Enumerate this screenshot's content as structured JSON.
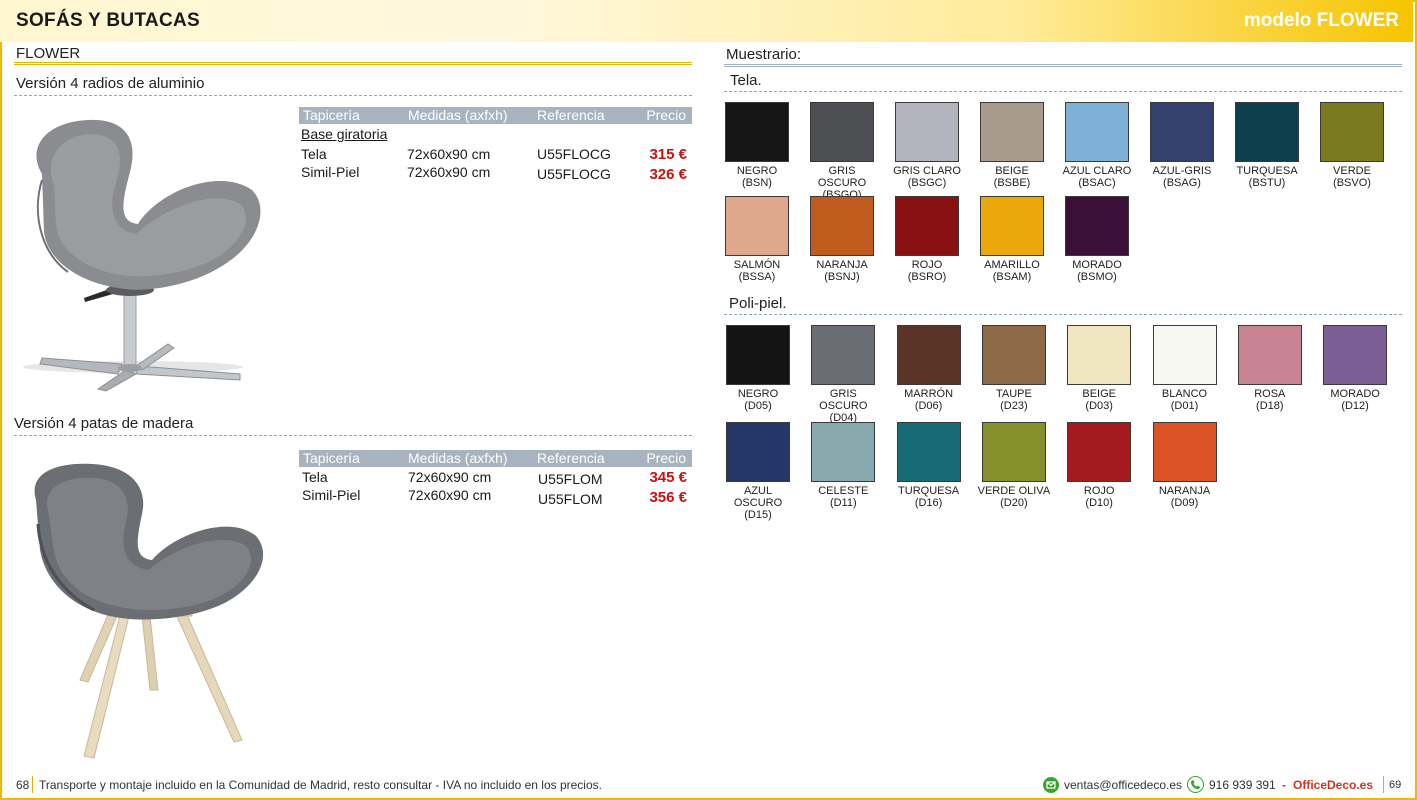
{
  "header": {
    "title": "SOFÁS Y BUTACAS",
    "model": "modelo FLOWER"
  },
  "left": {
    "product": "FLOWER",
    "version1": {
      "title": "Versión 4 radios de aluminio",
      "table_headers": [
        "Tapicería",
        "Medidas (axfxh)",
        "Referencia",
        "Precio"
      ],
      "subheading": "Base giratoria",
      "rows": [
        {
          "tapiceria": "Tela",
          "medidas": "72x60x90 cm",
          "referencia": "U55FLOCG",
          "precio": "315 €"
        },
        {
          "tapiceria": "Simil-Piel",
          "medidas": "72x60x90 cm",
          "referencia": "U55FLOCG",
          "precio": "326 €"
        }
      ]
    },
    "version2": {
      "title": "Versión 4 patas de madera",
      "table_headers": [
        "Tapicería",
        "Medidas (axfxh)",
        "Referencia",
        "Precio"
      ],
      "rows": [
        {
          "tapiceria": "Tela",
          "medidas": "72x60x90 cm",
          "referencia": "U55FLOM",
          "precio": "345 €"
        },
        {
          "tapiceria": "Simil-Piel",
          "medidas": "72x60x90 cm",
          "referencia": "U55FLOM",
          "precio": "356 €"
        }
      ]
    }
  },
  "muestrario": {
    "title": "Muestrario:",
    "tela_title": "Tela.",
    "tela": [
      {
        "name": "NEGRO",
        "code": "(BSN)",
        "color": "#151515"
      },
      {
        "name": "GRIS OSCURO",
        "code": "(BSGO)",
        "color": "#4e4f52"
      },
      {
        "name": "GRIS CLARO",
        "code": "(BSGC)",
        "color": "#b3b3bd"
      },
      {
        "name": "BEIGE",
        "code": "(BSBE)",
        "color": "#a89a8c"
      },
      {
        "name": "AZUL CLARO",
        "code": "(BSAC)",
        "color": "#7fb1d6"
      },
      {
        "name": "AZUL-GRIS",
        "code": "(BSAG)",
        "color": "#34406e"
      },
      {
        "name": "TURQUESA",
        "code": "(BSTU)",
        "color": "#0e3f4c"
      },
      {
        "name": "VERDE",
        "code": "(BSVO)",
        "color": "#7a7a1f"
      },
      {
        "name": "SALMÓN",
        "code": "(BSSA)",
        "color": "#e0a78f"
      },
      {
        "name": "NARANJA",
        "code": "(BSNJ)",
        "color": "#c05a1d"
      },
      {
        "name": "ROJO",
        "code": "(BSRO)",
        "color": "#8a1111"
      },
      {
        "name": "AMARILLO",
        "code": "(BSAM)",
        "color": "#eba80a"
      },
      {
        "name": "MORADO",
        "code": "(BSMO)",
        "color": "#3b1038"
      }
    ],
    "polipiel_title": "Poli-piel.",
    "polipiel": [
      {
        "name": "NEGRO",
        "code": "(D05)",
        "color": "#141414"
      },
      {
        "name": "GRIS OSCURO",
        "code": "(D04)",
        "color": "#6a6d73"
      },
      {
        "name": "MARRÓN",
        "code": "(D06)",
        "color": "#5a3427"
      },
      {
        "name": "TAUPE",
        "code": "(D23)",
        "color": "#8e6a48"
      },
      {
        "name": "BEIGE",
        "code": "(D03)",
        "color": "#efe6c0"
      },
      {
        "name": "BLANCO",
        "code": "(D01)",
        "color": "#f8f8f2"
      },
      {
        "name": "ROSA",
        "code": "(D18)",
        "color": "#c98494"
      },
      {
        "name": "MORADO",
        "code": "(D12)",
        "color": "#7b5f94"
      },
      {
        "name": "AZUL OSCURO",
        "code": "(D15)",
        "color": "#243766"
      },
      {
        "name": "CELESTE",
        "code": "(D11)",
        "color": "#88a9ad"
      },
      {
        "name": "TURQUESA",
        "code": "(D16)",
        "color": "#166b74"
      },
      {
        "name": "VERDE OLIVA",
        "code": "(D20)",
        "color": "#86902d"
      },
      {
        "name": "ROJO",
        "code": "(D10)",
        "color": "#a51a1f"
      },
      {
        "name": "NARANJA",
        "code": "(D09)",
        "color": "#dc5326"
      }
    ]
  },
  "footer": {
    "page_left": "68",
    "note": "Transporte y montaje incluido en la Comunidad de Madrid, resto consultar - IVA no incluido en los precios.",
    "email": "ventas@officedeco.es",
    "phone": "916 939 391",
    "separator": "-",
    "brand": "OfficeDeco.es",
    "page_right": "69"
  }
}
